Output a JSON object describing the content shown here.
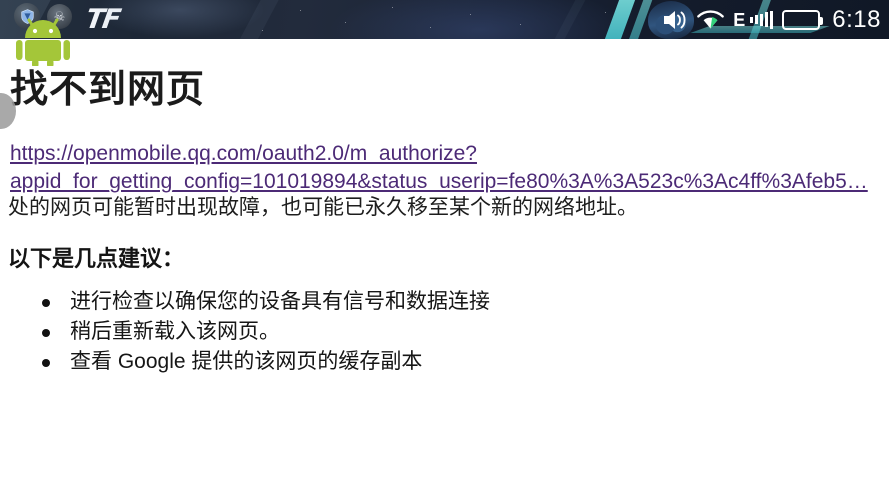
{
  "status_bar": {
    "app_logo_text": "TF",
    "tray_icons": [
      {
        "name": "shield-app-icon",
        "glyph": "◆"
      },
      {
        "name": "skull-app-icon",
        "glyph": "☠"
      }
    ],
    "volume_icon": "volume-icon",
    "wifi_icon": "wifi-icon",
    "network_type": "E",
    "signal_icon": "signal-bars-icon",
    "battery_icon": "battery-icon",
    "clock": "6:18",
    "text_color": "#ffffff",
    "background_color": "#1d2736"
  },
  "overlay": {
    "android_mascot": "android-robot-icon",
    "android_mascot_color": "#a4c639",
    "floating_handle": "floating-assistive-handle",
    "floating_handle_color": "#9a9a9a"
  },
  "page": {
    "title": "找不到网页",
    "url_lines": [
      "https://openmobile.qq.com/oauth2.0/m_authorize?",
      "appid_for_getting_config=101019894&status_userip=fe80%3A%3A523c%3Ac4ff%3Afeb5…"
    ],
    "url_color": "#4c2a76",
    "body_text": "处的网页可能暂时出现故障，也可能已永久移至某个新的网络地址。",
    "suggestions_heading": "以下是几点建议：",
    "suggestions": [
      "进行检查以确保您的设备具有信号和数据连接",
      "稍后重新载入该网页。",
      "查看 Google 提供的该网页的缓存副本"
    ]
  }
}
